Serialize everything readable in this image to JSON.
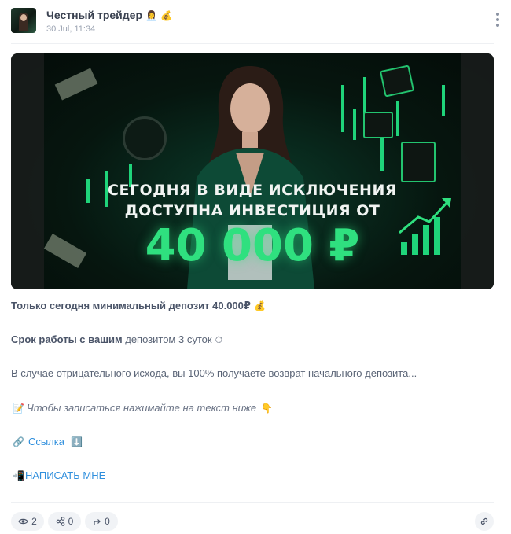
{
  "channel": {
    "name": "Честный трейдер",
    "name_emoji": "👩‍💼 💰",
    "date": "30 Jul, 11:34"
  },
  "banner": {
    "line1": "СЕГОДНЯ В ВИДЕ ИСКЛЮЧЕНИЯ",
    "line2": "ДОСТУПНА ИНВЕСТИЦИЯ ОТ",
    "amount": "40 000 ₽",
    "accent_color": "#2fe07f"
  },
  "post": {
    "p1_bold": "Только сегодня минимальный депозит 40.000₽",
    "p1_emoji": "💰",
    "p2_bold": "Срок работы с вашим",
    "p2_rest": " депозитом 3 суток",
    "p2_emoji": "⏱",
    "p3": "В случае отрицательного исхода, вы 100% получаете возврат начального депозита...",
    "p4_emoji_left": "📝",
    "p4": "Чтобы записаться нажимайте на текст ниже",
    "p4_emoji_right": "👇",
    "link_emoji": "🔗",
    "link_text": "Ссылка",
    "link_arrow": "⬇️",
    "write_emoji": "📲",
    "write_text": "НАПИСАТЬ МНЕ"
  },
  "stats": {
    "views": "2",
    "shares": "0",
    "forwards": "0"
  },
  "icons": [
    "more-vertical-icon",
    "eye-icon",
    "share-icon",
    "forward-icon",
    "link-icon"
  ]
}
